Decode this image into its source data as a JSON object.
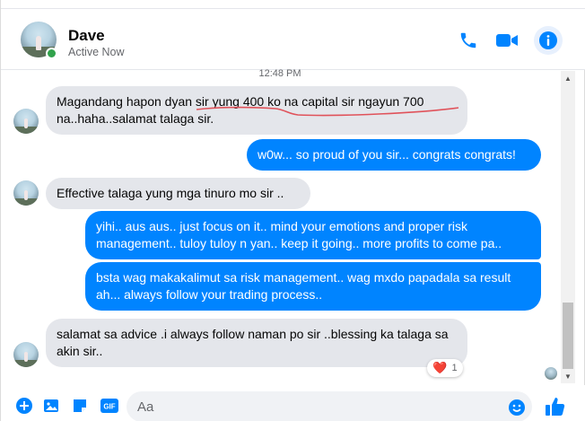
{
  "header": {
    "contact_name": "Dave",
    "contact_status": "Active Now"
  },
  "thread": {
    "timestamp": "12:48 PM",
    "messages": [
      {
        "from": "Dave",
        "text": "Magandang hapon dyan sir yung 400 ko na capital sir ngayun 700 na..haha..salamat talaga sir."
      },
      {
        "from": "me",
        "text": "w0w... so proud of you sir... congrats congrats!"
      },
      {
        "from": "Dave",
        "text": "Effective talaga yung mga tinuro mo sir .."
      },
      {
        "from": "me",
        "text": "yihi.. aus aus.. just focus on it.. mind your emotions and proper risk management.. tuloy tuloy n yan.. keep it going.. more profits to come pa.."
      },
      {
        "from": "me",
        "text": "bsta wag makakalimut sa risk management.. wag mxdo papadala sa result ah... always follow your trading process.."
      },
      {
        "from": "Dave",
        "text": "salamat sa advice .i always follow naman po sir ..blessing ka talaga sa akin sir.."
      }
    ],
    "reaction": {
      "emoji": "❤️",
      "count": "1"
    }
  },
  "composer": {
    "placeholder": "Aa"
  },
  "icons": {
    "header": [
      "phone-icon",
      "video-camera-icon",
      "info-icon"
    ],
    "composer": [
      "plus-icon",
      "image-icon",
      "sticker-icon",
      "gif-icon",
      "emoji-icon",
      "thumbs-up-icon"
    ]
  },
  "colors": {
    "accent": "#0084ff",
    "incoming_bubble": "#e4e6eb",
    "online": "#31a24c",
    "underline": "#e0525a"
  }
}
